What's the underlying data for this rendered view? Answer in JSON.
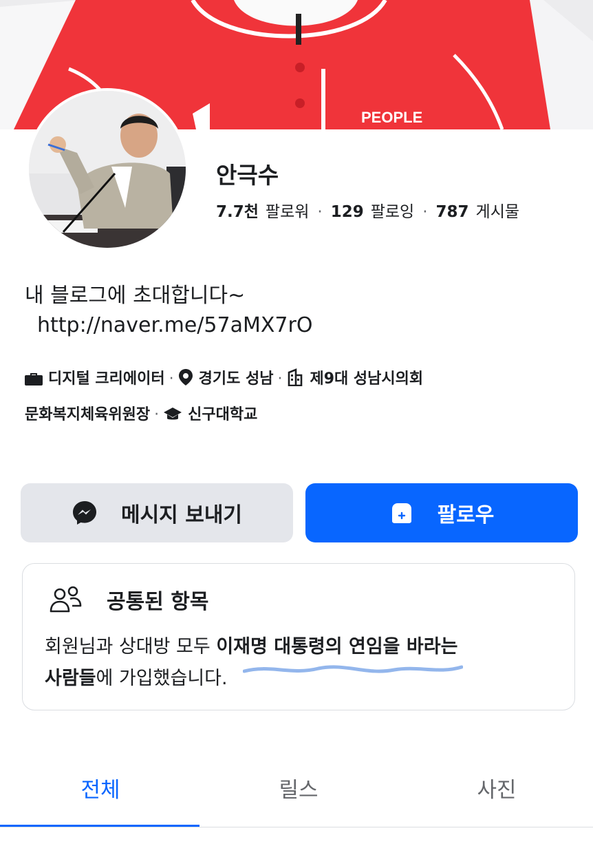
{
  "profile": {
    "name": "안극수",
    "followers_value": "7.7천",
    "followers_label": "팔로워",
    "following_value": "129",
    "following_label": "팔로잉",
    "posts_value": "787",
    "posts_label": "게시물",
    "dot": "·"
  },
  "bio": {
    "line1": "내 블로그에 초대합니다~",
    "link": "http://naver.me/57aMX7rO"
  },
  "details": {
    "category": "디지털 크리에이터",
    "location": "경기도 성남",
    "work_line1": "제9대 성남시의회",
    "work_line2": "문화복지체육위원장",
    "education": "신구대학교",
    "sep": "·"
  },
  "actions": {
    "message_label": "메시지 보내기",
    "follow_label": "팔로우"
  },
  "common": {
    "title": "공통된 항목",
    "text_prefix": "회원님과 상대방 모두 ",
    "group_name_part1": "이재명 대통령의 연임을 바라는",
    "group_name_part2": "사람들",
    "text_suffix": "에 가입했습니다."
  },
  "tabs": {
    "all": "전체",
    "reels": "릴스",
    "photos": "사진"
  },
  "colors": {
    "accent": "#0866ff",
    "button_gray": "#e4e6eb",
    "jersey_red": "#f0343a"
  },
  "icons": {
    "category": "briefcase-icon",
    "location": "location-pin-icon",
    "work": "building-icon",
    "education": "graduation-cap-icon",
    "message": "messenger-icon",
    "follow": "add-friend-icon",
    "common": "people-icon"
  }
}
